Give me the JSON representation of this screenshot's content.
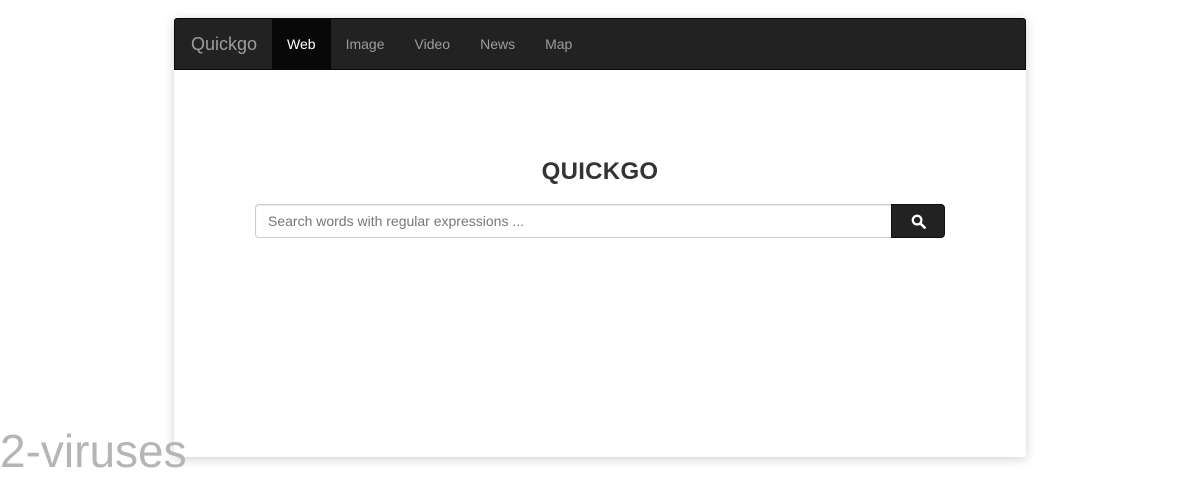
{
  "navbar": {
    "brand": "Quickgo",
    "items": [
      {
        "label": "Web",
        "active": true
      },
      {
        "label": "Image",
        "active": false
      },
      {
        "label": "Video",
        "active": false
      },
      {
        "label": "News",
        "active": false
      },
      {
        "label": "Map",
        "active": false
      }
    ]
  },
  "main": {
    "title": "QUICKGO",
    "search": {
      "placeholder": "Search words with regular expressions ...",
      "value": "",
      "button_icon": "search-icon"
    }
  },
  "watermark": {
    "text": "2-viruses"
  },
  "colors": {
    "navbar_bg": "#222222",
    "active_tab_bg": "#080808",
    "nav_text": "#9d9d9d",
    "active_text": "#ffffff",
    "button_bg": "#222222"
  }
}
